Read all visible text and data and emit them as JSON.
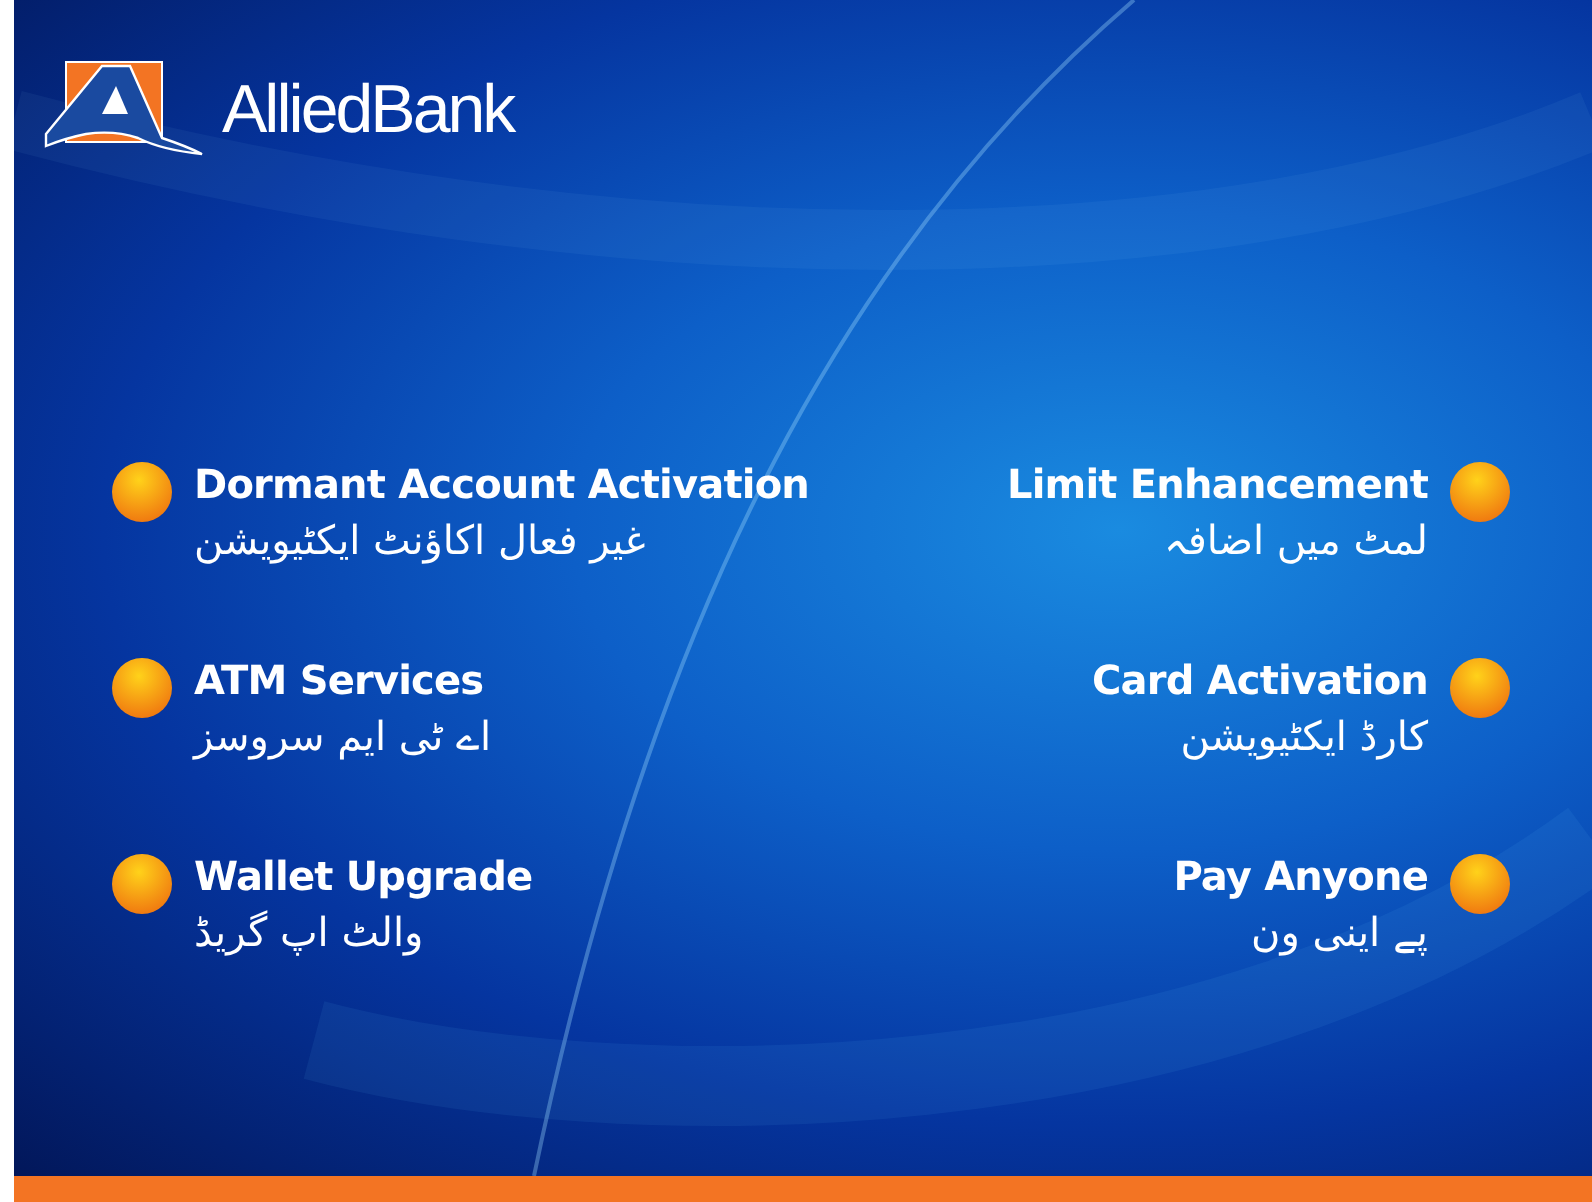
{
  "header": {
    "brand": "AlliedBank"
  },
  "options_left": [
    {
      "label": "Dormant Account Activation",
      "label_urdu": "غیر فعال اکاؤنٹ ایکٹیویشن"
    },
    {
      "label": "ATM Services",
      "label_urdu": "اے ٹی ایم سروسز"
    },
    {
      "label": "Wallet Upgrade",
      "label_urdu": "والٹ اپ گریڈ"
    }
  ],
  "options_right": [
    {
      "label": "Limit Enhancement",
      "label_urdu": "لمٹ میں اضافہ"
    },
    {
      "label": "Card Activation",
      "label_urdu": "کارڈ ایکٹیویشن"
    },
    {
      "label": "Pay Anyone",
      "label_urdu": "پے اینی ون"
    }
  ]
}
